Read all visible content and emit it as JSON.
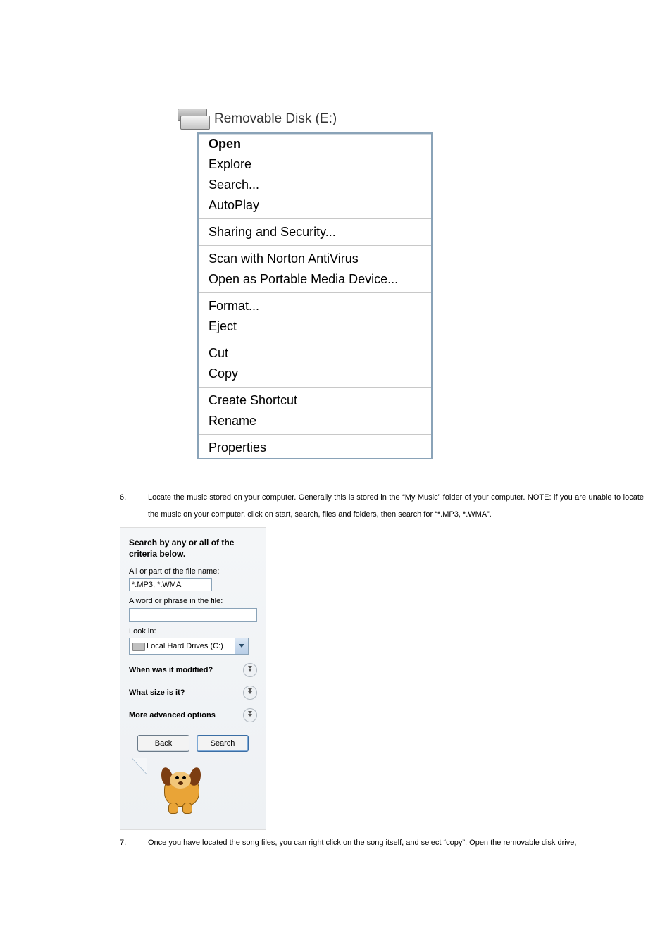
{
  "disk_header": {
    "title": "Removable Disk (E:)"
  },
  "context_menu": {
    "groups": [
      [
        "Open",
        "Explore",
        "Search...",
        "AutoPlay"
      ],
      [
        "Sharing and Security..."
      ],
      [
        "Scan with Norton AntiVirus",
        "Open as Portable Media Device..."
      ],
      [
        "Format...",
        "Eject"
      ],
      [
        "Cut",
        "Copy"
      ],
      [
        "Create Shortcut",
        "Rename"
      ],
      [
        "Properties"
      ]
    ],
    "bold_item": "Open"
  },
  "list_items": {
    "6": "Locate the music stored on your computer. Generally this is stored in the “My Music” folder of your computer. NOTE:  if you are unable to locate the music on your computer, click on start, search, files and folders, then search for “*.MP3, *.WMA”.",
    "7": "Once you have located the song files, you can right click on the song itself, and select “copy”.  Open the removable disk drive,"
  },
  "search_panel": {
    "title": "Search by any or all of the criteria below.",
    "label_filename": "All or part of the file name:",
    "value_filename": "*.MP3, *.WMA",
    "label_phrase": "A word or phrase in the file:",
    "value_phrase": "",
    "label_lookin": "Look in:",
    "lookin_value": "Local Hard Drives (C:)",
    "row_modified": "When was it modified?",
    "row_size": "What size is it?",
    "row_more": "More advanced options",
    "btn_back": "Back",
    "btn_search": "Search"
  }
}
